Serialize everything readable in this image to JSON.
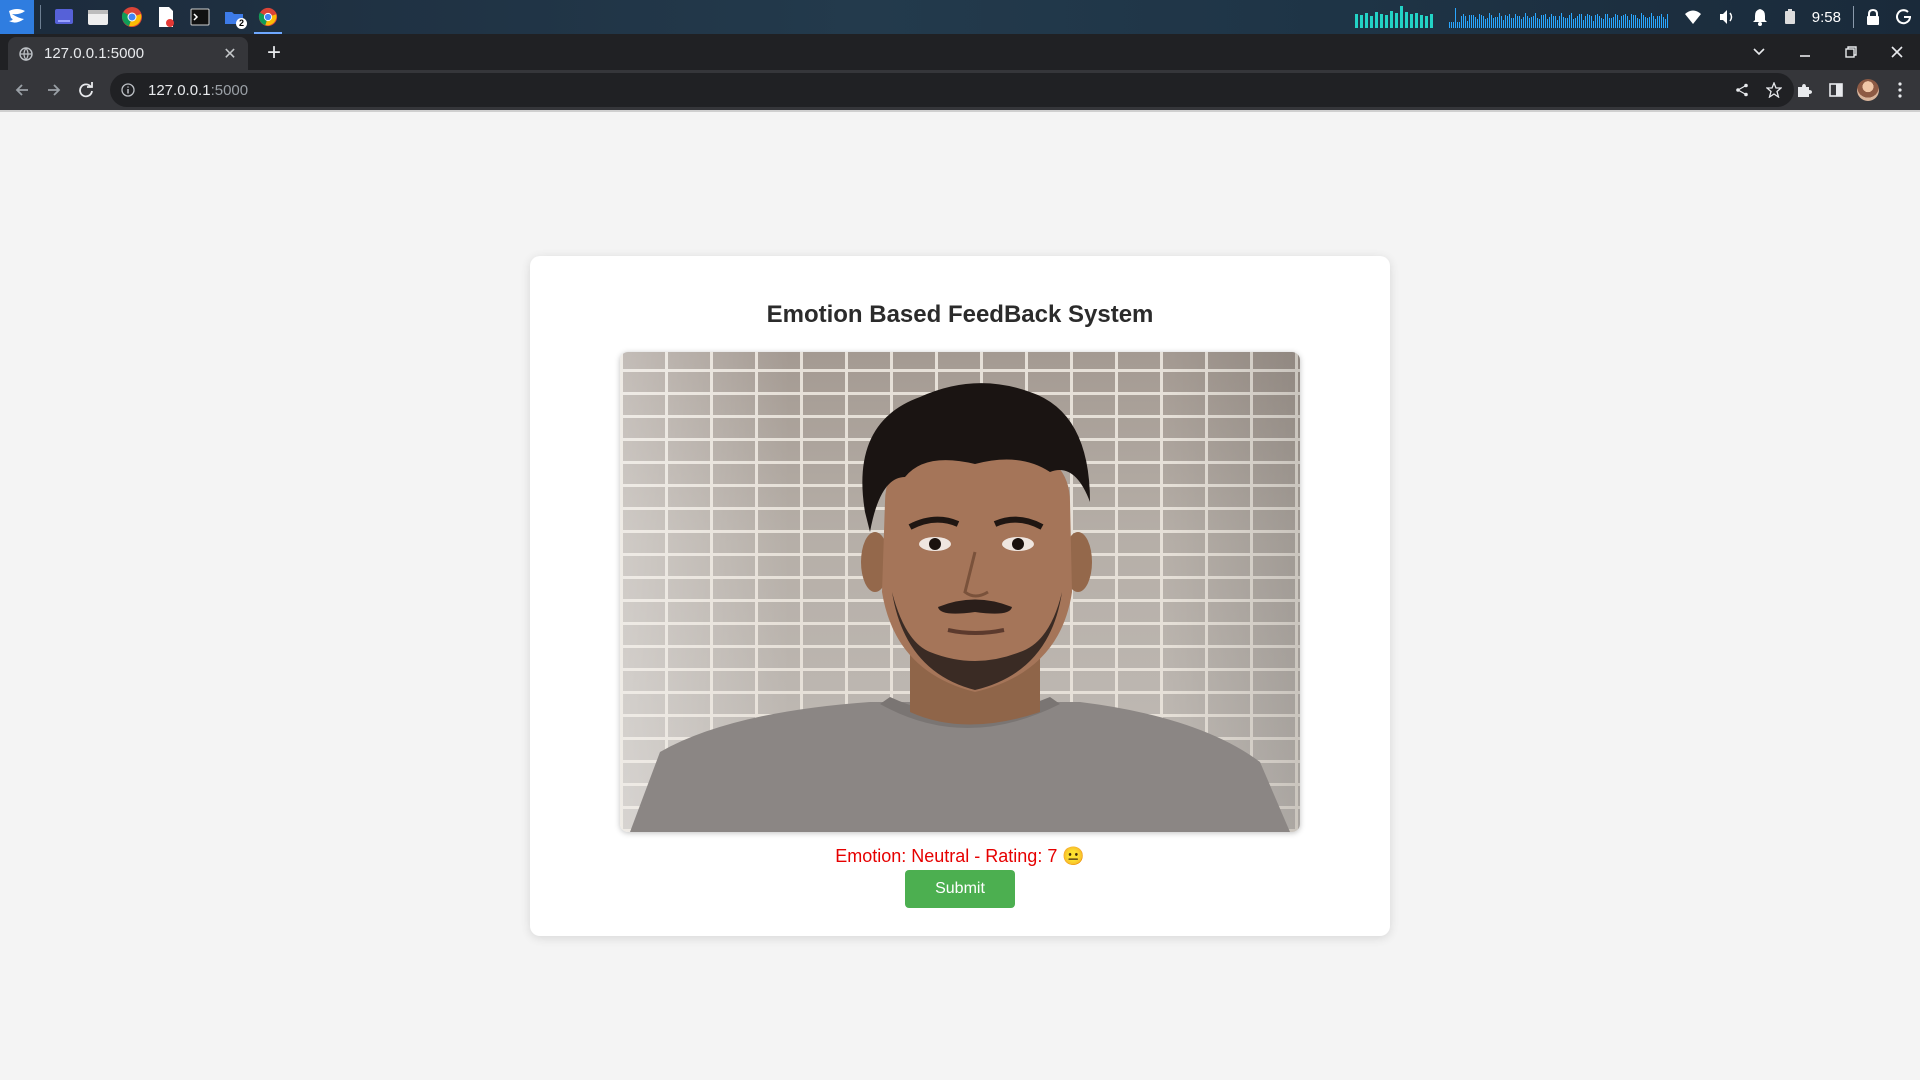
{
  "taskbar": {
    "apps": [
      "start-menu",
      "desktop",
      "file-manager",
      "chrome",
      "pdf-editor",
      "terminal",
      "folders",
      "chrome-active"
    ],
    "folders_badge": "2",
    "clock": "9:58"
  },
  "browser": {
    "tab_title": "127.0.0.1:5000",
    "url_host": "127.0.0.1",
    "url_rest": ":5000"
  },
  "page": {
    "title": "Emotion Based FeedBack System",
    "emotion_text": "Emotion: Neutral - Rating: 7 😐",
    "submit_label": "Submit"
  },
  "colors": {
    "page_bg": "#f4f4f4",
    "emotion_text": "#e60000",
    "submit_bg": "#4caf50",
    "chrome_dark": "#202124"
  }
}
